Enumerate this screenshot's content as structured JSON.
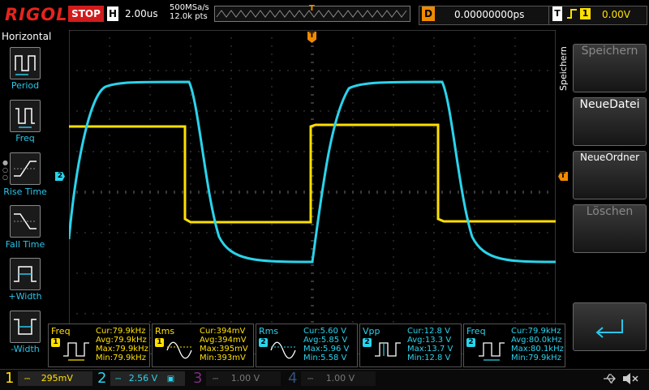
{
  "header": {
    "brand": "RIGOL",
    "run_state": "STOP",
    "timebase_label": "H",
    "timebase_value": "2.00us",
    "sample_rate": "500MSa/s",
    "memory_depth": "12.0k pts",
    "trigger_position_marker": "T",
    "delay_label": "D",
    "delay_value": "0.00000000ps",
    "trigger_label": "T",
    "trigger_edge_icon": "rising-edge-icon",
    "trigger_source": "1",
    "trigger_level": "0.00V"
  },
  "left_panel": {
    "title": "Horizontal",
    "items": [
      {
        "label": "Period",
        "icon": "period-icon"
      },
      {
        "label": "Freq",
        "icon": "freq-icon"
      },
      {
        "label": "Rise Time",
        "icon": "rise-time-icon"
      },
      {
        "label": "Fall Time",
        "icon": "fall-time-icon"
      },
      {
        "label": "+Width",
        "icon": "positive-width-icon"
      },
      {
        "label": "-Width",
        "icon": "negative-width-icon"
      }
    ]
  },
  "right_panel": {
    "title": "Speichern",
    "buttons": [
      {
        "label": "Speichern",
        "enabled": false
      },
      {
        "label": "NeueDatei",
        "enabled": true
      },
      {
        "label": "NeueOrdner",
        "enabled": true
      },
      {
        "label": "Löschen",
        "enabled": false
      },
      {
        "label": "",
        "icon": "enter-return-icon",
        "enabled": true
      }
    ]
  },
  "markers": {
    "ch2_level": "2",
    "trigger_level": "T",
    "trigger_time": "T"
  },
  "measurements": [
    {
      "name": "Freq",
      "channel": "1",
      "icon": "freq-wave-icon",
      "cur": "Cur:79.9kHz",
      "avg": "Avg:79.9kHz",
      "max": "Max:79.9kHz",
      "min": "Min:79.9kHz"
    },
    {
      "name": "Rms",
      "channel": "1",
      "icon": "rms-wave-icon",
      "cur": "Cur:394mV",
      "avg": "Avg:394mV",
      "max": "Max:395mV",
      "min": "Min:393mV"
    },
    {
      "name": "Rms",
      "channel": "2",
      "icon": "rms-wave-icon",
      "cur": "Cur:5.60 V",
      "avg": "Avg:5.85 V",
      "max": "Max:5.96 V",
      "min": "Min:5.58 V"
    },
    {
      "name": "Vpp",
      "channel": "2",
      "icon": "vpp-wave-icon",
      "cur": "Cur:12.8 V",
      "avg": "Avg:13.3 V",
      "max": "Max:13.7 V",
      "min": "Min:12.8 V"
    },
    {
      "name": "Freq",
      "channel": "2",
      "icon": "freq-wave-icon",
      "cur": "Cur:79.9kHz",
      "avg": "Avg:80.0kHz",
      "max": "Max:80.1kHz",
      "min": "Min:79.9kHz"
    }
  ],
  "channels": [
    {
      "number": "1",
      "coupling": "DC",
      "scale": "295mV",
      "active": true
    },
    {
      "number": "2",
      "coupling": "DC",
      "scale": "2.56 V",
      "active": true,
      "extra_icon": "bandwidth-limit-icon"
    },
    {
      "number": "3",
      "coupling": "DC",
      "scale": "1.00 V",
      "active": false
    },
    {
      "number": "4",
      "coupling": "DC",
      "scale": "1.00 V",
      "active": false
    }
  ],
  "status_icons": [
    "usb-icon",
    "speaker-muted-icon"
  ],
  "colors": {
    "ch1": "#ffff00",
    "ch2": "#2ad4ec",
    "ch3": "#d04bd0",
    "ch4": "#3a7be0",
    "trigger": "#f08a00",
    "stop": "#d21c1c",
    "brand": "#e8231c"
  }
}
